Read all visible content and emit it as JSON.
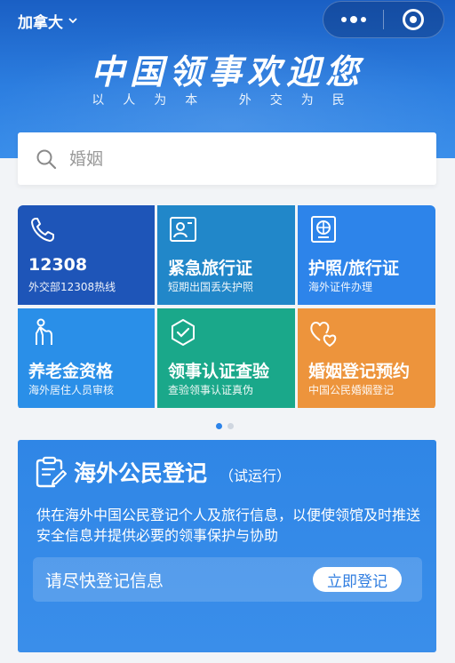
{
  "header": {
    "region": "加拿大",
    "hero_title": "中国领事欢迎您",
    "hero_subtitle": "以人为本 外交为民"
  },
  "search": {
    "placeholder": "婚姻"
  },
  "services": [
    {
      "name": "12308",
      "desc": "外交部12308热线",
      "icon": "phone-icon",
      "color": "#1e55b8"
    },
    {
      "name": "紧急旅行证",
      "desc": "短期出国丢失护照",
      "icon": "id-card-icon",
      "color": "#2187c9"
    },
    {
      "name": "护照/旅行证",
      "desc": "海外证件办理",
      "icon": "passport-icon",
      "color": "#2d84ea"
    },
    {
      "name": "养老金资格",
      "desc": "海外居住人员审核",
      "icon": "elderly-icon",
      "color": "#2a8fe8"
    },
    {
      "name": "领事认证查验",
      "desc": "查验领事认证真伪",
      "icon": "shield-check-icon",
      "color": "#1aa88a"
    },
    {
      "name": "婚姻登记预约",
      "desc": "中国公民婚姻登记",
      "icon": "hearts-icon",
      "color": "#ed943c"
    }
  ],
  "pager": {
    "active_color": "#2d84ea",
    "inactive_color": "#cfd6e0"
  },
  "registration": {
    "title": "海外公民登记",
    "tag": "（试运行）",
    "description": "供在海外中国公民登记个人及旅行信息，以便使领馆及时推送安全信息并提供必要的领事保护与协助",
    "prompt": "请尽快登记信息",
    "button": "立即登记"
  }
}
